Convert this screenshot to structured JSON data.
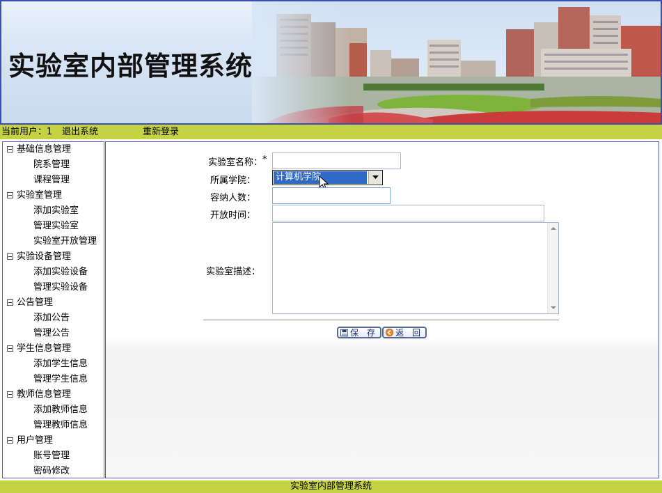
{
  "app": {
    "title": "实验室内部管理系统"
  },
  "status_bar": {
    "current_user": "当前用户：1",
    "logout": "退出系统",
    "relogin": "重新登录"
  },
  "sidebar": {
    "groups": [
      {
        "label": "基础信息管理",
        "items": [
          "院系管理",
          "课程管理"
        ]
      },
      {
        "label": "实验室管理",
        "items": [
          "添加实验室",
          "管理实验室",
          "实验室开放管理"
        ]
      },
      {
        "label": "实验设备管理",
        "items": [
          "添加实验设备",
          "管理实验设备"
        ]
      },
      {
        "label": "公告管理",
        "items": [
          "添加公告",
          "管理公告"
        ]
      },
      {
        "label": "学生信息管理",
        "items": [
          "添加学生信息",
          "管理学生信息"
        ]
      },
      {
        "label": "教师信息管理",
        "items": [
          "添加教师信息",
          "管理教师信息"
        ]
      },
      {
        "label": "用户管理",
        "items": [
          "账号管理",
          "密码修改"
        ]
      }
    ]
  },
  "form": {
    "lab_name_label": "实验室名称：",
    "required_mark": "*",
    "lab_name_value": "",
    "college_label": "所属学院：",
    "college_selected": "计算机学院",
    "capacity_label": "容纳人数：",
    "capacity_value": "",
    "open_time_label": "开放时间：",
    "open_time_value": "",
    "description_label": "实验室描述：",
    "description_value": ""
  },
  "buttons": {
    "save": "保 存",
    "back": "返 回"
  },
  "footer": {
    "text": "实验室内部管理系统"
  },
  "colors": {
    "accent_bar": "#c4d243",
    "border_blue": "#4a5fc4",
    "selection_blue": "#3169c6"
  }
}
